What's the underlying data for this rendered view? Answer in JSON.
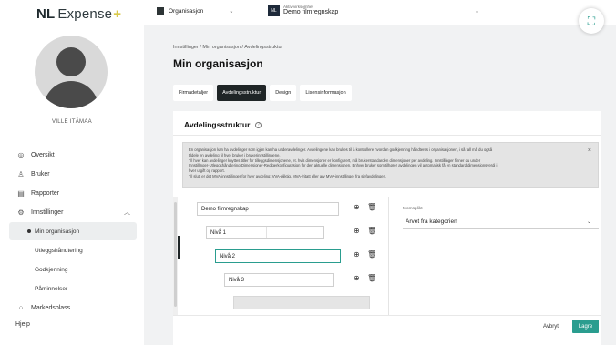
{
  "brand": {
    "nl": "NL",
    "name": "Expense",
    "plus": "+"
  },
  "user": {
    "name": "VILLE ITÄMAA"
  },
  "sidebar": {
    "items": [
      {
        "label": "Oversikt",
        "icon": "eye-icon"
      },
      {
        "label": "Bruker",
        "icon": "users-icon"
      },
      {
        "label": "Rapporter",
        "icon": "clipboard-icon"
      },
      {
        "label": "Innstillinger",
        "icon": "gear-icon"
      }
    ],
    "settings_children": [
      {
        "label": "Min organisasjon",
        "active": true
      },
      {
        "label": "Utleggshåndtering"
      },
      {
        "label": "Godkjenning"
      },
      {
        "label": "Påminnelser"
      }
    ],
    "marketplace": "Markedsplass",
    "help": "Hjelp"
  },
  "topbar": {
    "org_label": "Organisasjon",
    "acct_small": "Aktiv virksomhet",
    "acct_name": "Demo filmregnskap",
    "acct_badge": "NL"
  },
  "breadcrumb": "Innstillinger / Min organisasjon / Avdelingsstruktur",
  "page_title": "Min organisasjon",
  "tabs": [
    {
      "label": "Firmadetaljer",
      "active": false
    },
    {
      "label": "Avdelingsstruktur",
      "active": true
    },
    {
      "label": "Design",
      "active": false
    },
    {
      "label": "Lisensinformasjon",
      "active": false
    }
  ],
  "section": {
    "title": "Avdelingsstruktur",
    "help_icon": "?",
    "info_lines": [
      "En organisasjon kan ha avdelinger som igjen kan ha underavdelinger. Avdelingene kan brukes til å kontrollere hvordan godkjenning håndteres i organisasjonen, i så fall må du også",
      "tildele en avdeling til hver bruker i brukerinnstillingene.",
      "Til hver kan avdelinger knyttes titler for tilleggsdimensjonene, et. hvis dimensjoner er konfigurert, må brukerstandarden dimensjoner per avdeling. Innstillinger finner du under",
      "Innstillinger-Utleggshåndtering-Dimensjoner-Redigerkonfigurasjon for den aktuelle dimensjonen. Enhver bruker som tilhører avdelingen vil automatisk få en standard dimensjonsverdi i",
      "hver utgift og rapport.",
      "Til slutt er det MVA-innstillinger for hver avdeling: VVA-pliktig, MVA-fritatt eller arv MVA-innstillinger fra sjefavdelingen."
    ],
    "close_icon": "×"
  },
  "tree": {
    "nodes": [
      {
        "label": "Demo filmregnskap"
      },
      {
        "label": "Nivå 1"
      },
      {
        "label": "Nivå 2"
      },
      {
        "label": "Nivå 3"
      }
    ]
  },
  "panel": {
    "label": "Momsplikt",
    "value": "Arvet fra kategorien"
  },
  "footer": {
    "cancel": "Avbryt",
    "save": "Lagre"
  },
  "colors": {
    "accent": "#2a9d8f",
    "dark": "#1f2526",
    "brand_plus": "#d9c94a"
  }
}
